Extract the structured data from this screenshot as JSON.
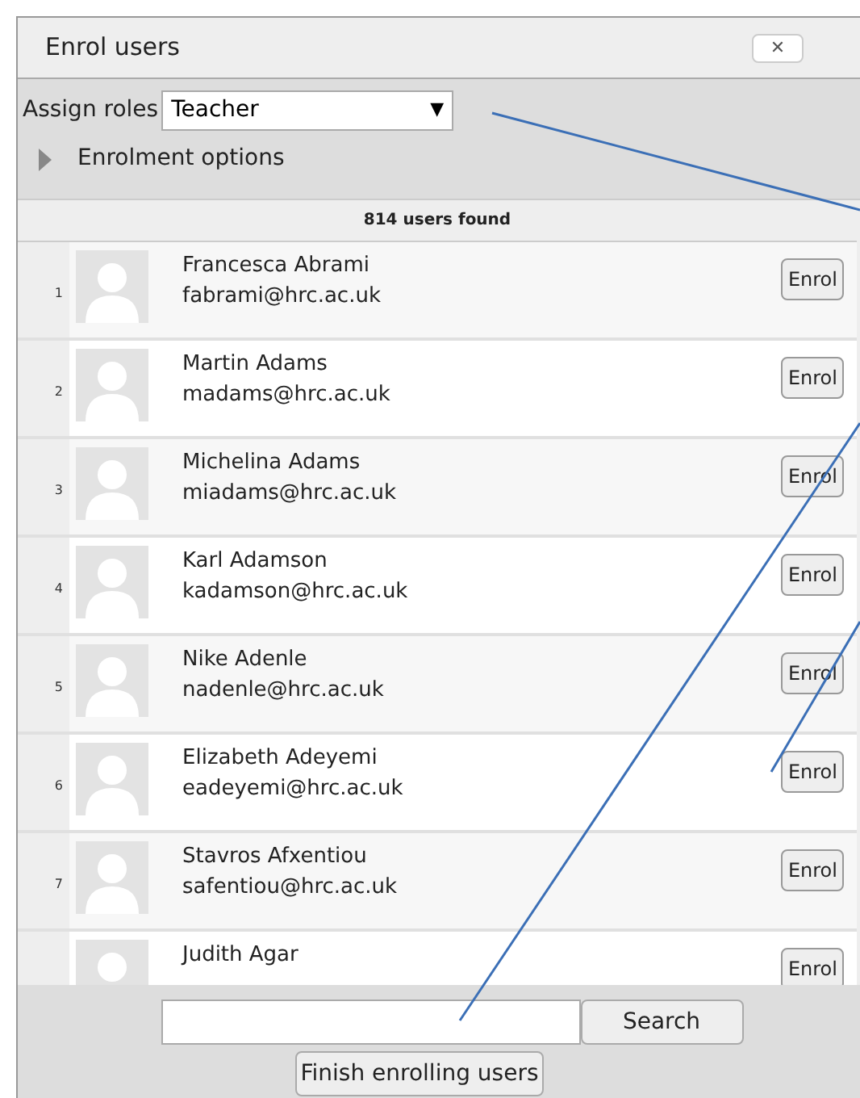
{
  "window": {
    "title": "Enrol users",
    "close": "✕"
  },
  "assign_roles": {
    "label": "Assign roles",
    "value": "Teacher",
    "caret": "▼"
  },
  "enrolment_options": {
    "label": "Enrolment options",
    "expanded": false
  },
  "count": "814 users found",
  "users": [
    {
      "number": "1",
      "name": "Francesca Abrami",
      "email": "fabrami@hrc.ac.uk",
      "button": "Enrol"
    },
    {
      "number": "2",
      "name": "Martin Adams",
      "email": "madams@hrc.ac.uk",
      "button": "Enrol"
    },
    {
      "number": "3",
      "name": "Michelina Adams",
      "email": "miadams@hrc.ac.uk",
      "button": "Enrol"
    },
    {
      "number": "4",
      "name": "Karl Adamson",
      "email": "kadamson@hrc.ac.uk",
      "button": "Enrol"
    },
    {
      "number": "5",
      "name": "Nike Adenle",
      "email": "nadenle@hrc.ac.uk",
      "button": "Enrol"
    },
    {
      "number": "6",
      "name": "Elizabeth Adeyemi",
      "email": "eadeyemi@hrc.ac.uk",
      "button": "Enrol"
    },
    {
      "number": "7",
      "name": "Stavros Afxentiou",
      "email": "safentiou@hrc.ac.uk",
      "button": "Enrol"
    },
    {
      "name": "Judith Agar",
      "button": "Enrol"
    }
  ],
  "search": {
    "button": "Search"
  },
  "finish_button": "Finish enrolling users"
}
